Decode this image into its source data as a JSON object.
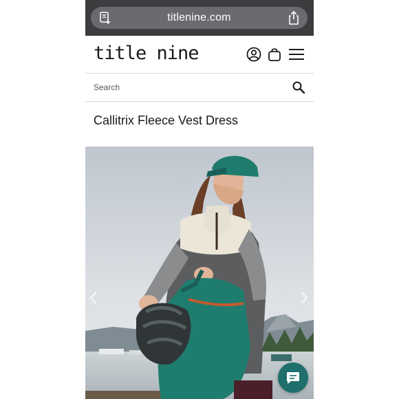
{
  "browser": {
    "url": "titlenine.com",
    "reader_icon": "reader-icon",
    "share_icon": "share-icon"
  },
  "header": {
    "logo": "title nine",
    "account_icon": "account-icon",
    "bag_icon": "bag-icon",
    "menu_icon": "menu-icon"
  },
  "search": {
    "placeholder": "Search",
    "icon": "search-icon"
  },
  "product": {
    "title": "Callitrix Fleece Vest Dress"
  },
  "carousel": {
    "prev_icon": "chevron-left-icon",
    "next_icon": "chevron-right-icon"
  },
  "chat": {
    "icon": "chat-icon"
  },
  "colors": {
    "browser_bar": "#3c3d3f",
    "url_pill": "#6a6b6e",
    "chat_button": "#1f6f6d"
  }
}
